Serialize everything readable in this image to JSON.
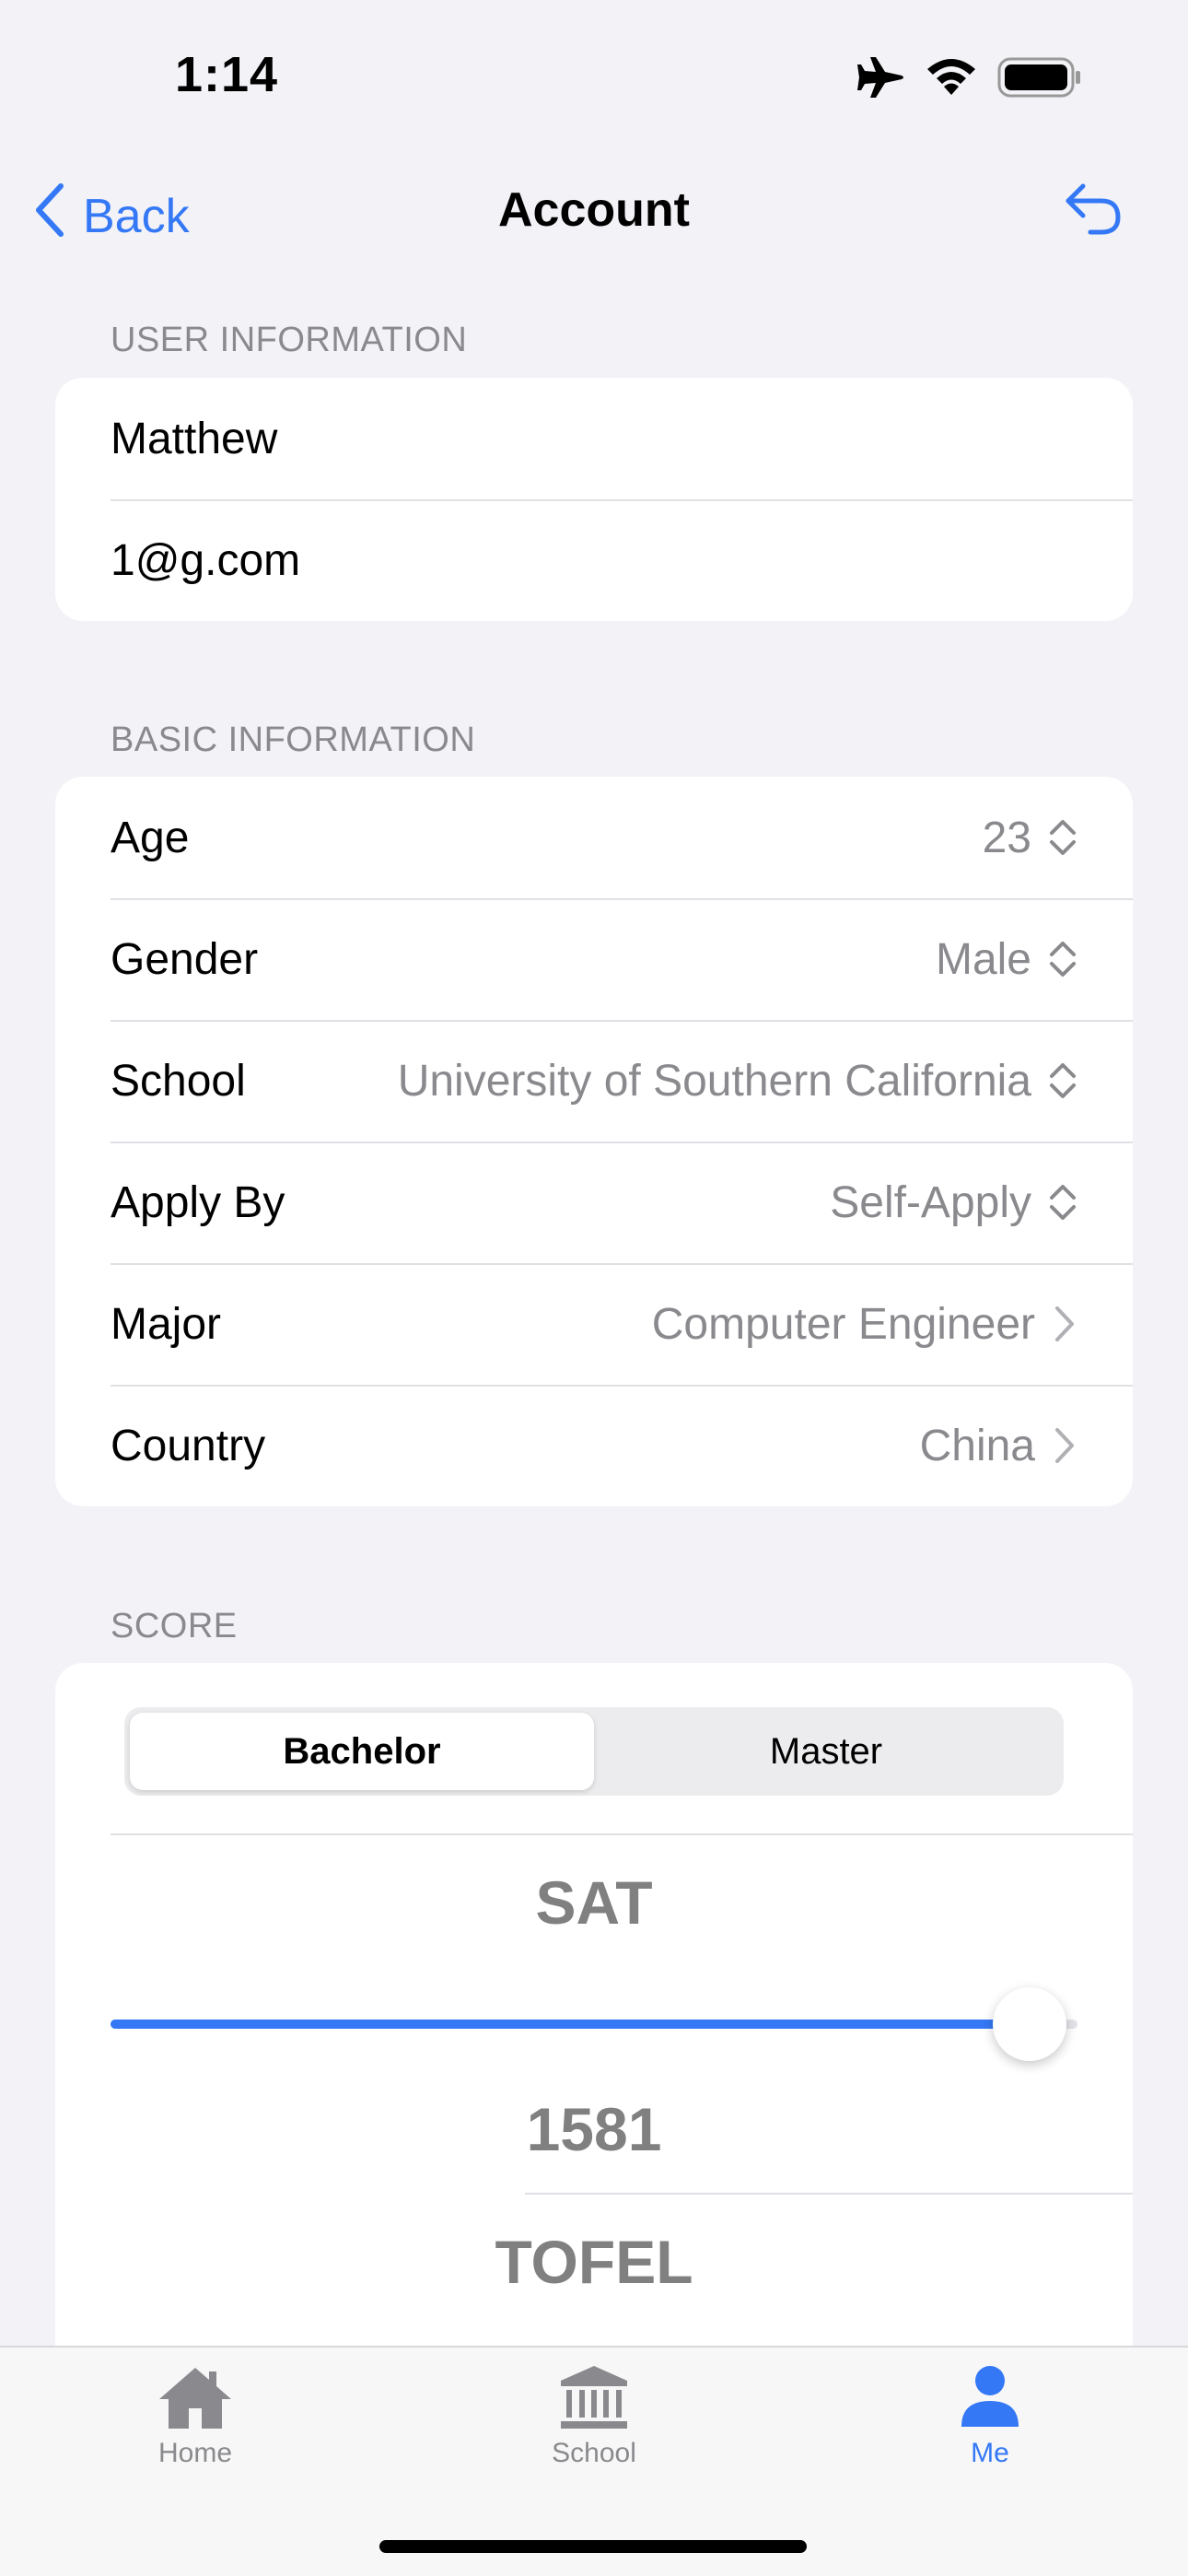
{
  "status_bar": {
    "time": "1:14"
  },
  "nav": {
    "back_label": "Back",
    "title": "Account"
  },
  "user_info": {
    "header": "USER INFORMATION",
    "name": "Matthew",
    "email": "1@g.com"
  },
  "basic_info": {
    "header": "BASIC INFORMATION",
    "rows": [
      {
        "label": "Age",
        "value": "23",
        "icon": "chevron-up-down-icon"
      },
      {
        "label": "Gender",
        "value": "Male",
        "icon": "chevron-up-down-icon"
      },
      {
        "label": "School",
        "value": "University of Southern California",
        "icon": "chevron-up-down-icon"
      },
      {
        "label": "Apply By",
        "value": "Self-Apply",
        "icon": "chevron-up-down-icon"
      },
      {
        "label": "Major",
        "value": "Computer Engineer",
        "icon": "chevron-right-icon"
      },
      {
        "label": "Country",
        "value": "China",
        "icon": "chevron-right-icon"
      }
    ]
  },
  "score": {
    "header": "SCORE",
    "segments": [
      "Bachelor",
      "Master"
    ],
    "selected_segment": "Bachelor",
    "sat_label": "SAT",
    "sat_value": "1581",
    "sat_slider_fraction": 0.95,
    "tofel_label": "TOFEL"
  },
  "tab_bar": {
    "tabs": [
      {
        "label": "Home",
        "icon": "house-icon"
      },
      {
        "label": "School",
        "icon": "building-columns-icon"
      },
      {
        "label": "Me",
        "icon": "person-icon"
      }
    ],
    "active": "Me"
  },
  "colors": {
    "accent": "#3478f6",
    "secondary_text": "#8a8a8e",
    "background": "#f2f2f7"
  }
}
